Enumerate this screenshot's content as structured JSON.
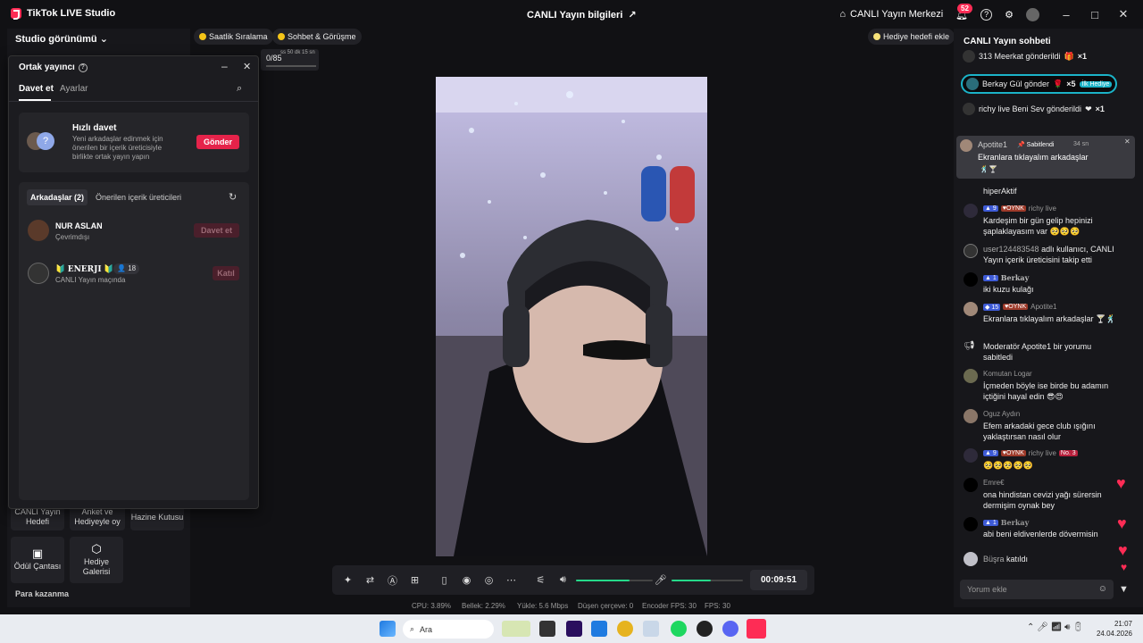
{
  "titlebar": {
    "app_name": "TikTok LIVE Studio",
    "live_info": "CANLI Yayın bilgileri",
    "live_center": "CANLI Yayın Merkezi",
    "notif_count": "52"
  },
  "left": {
    "studio_view": "Studio görünümü",
    "tiles": [
      "CANLI Yayın Hedefi",
      "Anket ve Hediyeyle oy",
      "Hazine Kutusu",
      "Ödül Çantası",
      "Hediye Galerisi"
    ],
    "earn": "Para kazanma"
  },
  "pills": {
    "hourly_rank": "Saatlik Sıralama",
    "chat_meet": "Sohbet & Görüşme",
    "gift_goal": "Hediye hedefi ekle",
    "progress": "0/85",
    "progress_time": "ss 50 dk 15 sn"
  },
  "popup": {
    "title": "Ortak yayıncı",
    "tabs": [
      "Davet et",
      "Ayarlar"
    ],
    "quick_title": "Hızlı davet",
    "quick_desc": "Yeni arkadaşlar edinmek için önerilen bir içerik üreticisiyle birlikte ortak yayın yapın",
    "send": "Gönder",
    "sub_tabs": [
      "Arkadaşlar (2)",
      "Önerilen içerik üreticileri"
    ],
    "friends": [
      {
        "name": "NUR ASLAN",
        "status": "Çevrimdışı",
        "action": "Davet et"
      },
      {
        "name": "ENERJI",
        "status": "CANLI Yayın maçında",
        "count": "18",
        "action": "Katıl"
      }
    ]
  },
  "controls": {
    "timer": "00:09:51",
    "mic_level": 0.55,
    "speaker_level": 0.7
  },
  "stats": {
    "cpu": "CPU: 3.89%",
    "memory": "Bellek: 2.29%",
    "upload": "Yükle: 5.6 Mbps",
    "dropped": "Düşen çerçeve: 0",
    "encoder": "Encoder FPS: 30",
    "fps": "FPS: 30"
  },
  "chat": {
    "title": "CANLI Yayın sohbeti",
    "events": [
      {
        "text": "313 Meerkat gönderildi",
        "mult": "×1"
      },
      {
        "text": "Berkay Gül gönder",
        "mult": "×5",
        "tag": "İlk Hediye"
      },
      {
        "text": "richy live Beni Sev gönderildi",
        "mult": "×1"
      }
    ],
    "pinned": {
      "user": "Apotite1",
      "tag": "Sabitlendi",
      "age": "34 sn",
      "text": "Ekranlara tıklayalım arkadaşlar"
    },
    "messages": [
      {
        "head": "hiperAktif",
        "lvl": "",
        "user": ""
      },
      {
        "lvl": "9",
        "oynk": "OYNK",
        "user": "richy live",
        "text": "Kardeşim bir gün gelip hepinizi şaplaklayasım var 🥺🥺🥺"
      },
      {
        "user": "user124483548",
        "text": "adlı kullanıcı, CANLI Yayın içerik üreticisini takip etti"
      },
      {
        "lvl": "1",
        "user": "Berkay",
        "text": "iki kuzu kulağı"
      },
      {
        "lvl": "15",
        "oynk": "OYNK",
        "user": "Apotite1",
        "text": "Ekranlara tıklayalım arkadaşlar 🍸🕺"
      },
      {
        "user": "Moderatör",
        "text": "Apotite1 bir yorumu sabitledi"
      },
      {
        "user": "Komutan Logar",
        "text": "İçmeden böyle ise birde bu adamın içtiğini hayal edin 😎😍"
      },
      {
        "user": "Oguz Aydın",
        "text": "Efem arkadaki gece club ışığını yaklaştırsan nasıl olur"
      },
      {
        "lvl": "9",
        "oynk": "OYNK",
        "user": "richy live",
        "no": "No. 3",
        "text": "🥺🥺🥺🥺🥺"
      },
      {
        "user": "Emre€",
        "text": "ona hindistan cevizi yağı sürersin dermişim oynak bey"
      },
      {
        "lvl": "1",
        "user": "Berkay",
        "text": "abi beni eldivenlerde dövermisin"
      },
      {
        "user": "Büşra",
        "text": "katıldı"
      }
    ],
    "comment_placeholder": "Yorum ekle"
  },
  "taskbar": {
    "search": "Ara",
    "time": "21:07",
    "date": "24.04.2026"
  }
}
